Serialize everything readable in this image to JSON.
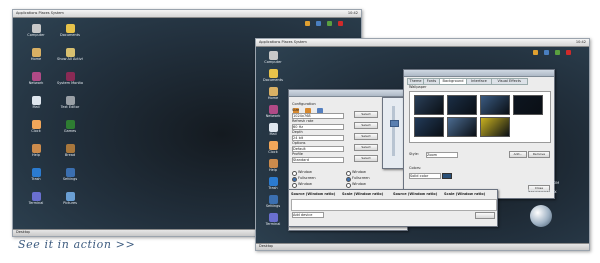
{
  "caption": "See it in action >>",
  "left_screen": {
    "top_panel": {
      "start_label": "Applications  Places  System",
      "clock": "10:42"
    },
    "desktop_icons": [
      {
        "label": "Computer",
        "color": "#c8c8c8"
      },
      {
        "label": "Documents",
        "color": "#e8c34a"
      },
      {
        "label": "Home",
        "color": "#d9b064"
      },
      {
        "label": "Show All Activity",
        "color": "#d8c070"
      },
      {
        "label": "Network",
        "color": "#b04a86"
      },
      {
        "label": "System Monitor",
        "color": "#8a2a55"
      },
      {
        "label": "Mail",
        "color": "#dfe6ee"
      },
      {
        "label": "Text Editor",
        "color": "#9aa0a6"
      },
      {
        "label": "Clock",
        "color": "#f0a65a"
      },
      {
        "label": "Games",
        "color": "#2e7d32"
      },
      {
        "label": "Help",
        "color": "#cc8b4c"
      },
      {
        "label": "Bread",
        "color": "#a8773c"
      },
      {
        "label": "Trash",
        "color": "#2b7bd0"
      },
      {
        "label": "Settings",
        "color": "#3b6fb0"
      },
      {
        "label": "Terminal",
        "color": "#6a6fcf"
      },
      {
        "label": "Pictures",
        "color": "#6a9fd4"
      }
    ],
    "bottom_panel": {
      "start_label": "Desktop"
    }
  },
  "right_screen": {
    "top_panel": {
      "start_label": "Applications  Places  System",
      "clock": "10:42"
    },
    "desktop_icons": [
      {
        "label": "Computer",
        "color": "#c8c8c8"
      },
      {
        "label": "Documents",
        "color": "#e8c34a"
      },
      {
        "label": "Home",
        "color": "#d9b064"
      },
      {
        "label": "Network",
        "color": "#b04a86"
      },
      {
        "label": "Mail",
        "color": "#dfe6ee"
      },
      {
        "label": "Clock",
        "color": "#f0a65a"
      },
      {
        "label": "Help",
        "color": "#cc8b4c"
      },
      {
        "label": "Trash",
        "color": "#2b7bd0"
      },
      {
        "label": "Settings",
        "color": "#3b6fb0"
      },
      {
        "label": "Terminal",
        "color": "#6a6fcf"
      }
    ],
    "appearance_dialog": {
      "title": "Appearance Preferences",
      "tabs": [
        "Theme",
        "Fonts",
        "Background",
        "Interface",
        "Visual Effects"
      ],
      "active_tab": "Background",
      "section_label": "Wallpaper",
      "thumb_colors": [
        "#2a3f58",
        "#1b2e45",
        "#3a5a80",
        "#0d1520",
        "#223a58",
        "#4b6b90",
        "#c8b020"
      ],
      "style_label": "Style:",
      "style_value": "Zoom",
      "colors_label": "Colors:",
      "colors_value": "Solid color",
      "add_button": "Add...",
      "remove_button": "Remove",
      "close_button": "Close"
    },
    "config_dialog": {
      "title": "Configuration",
      "rows": [
        {
          "label": "Size",
          "value": "1024x768",
          "button": "Select"
        },
        {
          "label": "Refresh rate",
          "value": "60 Hz",
          "button": "Select"
        },
        {
          "label": "Depth",
          "value": "24 bit",
          "button": "Select"
        },
        {
          "label": "Options",
          "value": "Default",
          "button": "Select"
        },
        {
          "label": "Profile",
          "value": "Standard",
          "button": "Select"
        }
      ],
      "radio_left": [
        "Window",
        "Fullscreen",
        "Window"
      ],
      "radio_right": [
        "Window",
        "Fullscreen",
        "Window"
      ],
      "columns": [
        "Source (Window ratio)",
        "Scale (Window ratio)",
        "Source (Window ratio)",
        "Scale (Window ratio)"
      ],
      "footer_field": "Add device"
    },
    "logo": {
      "line1": "YOUR OS FREEDOM",
      "line2": "Dreamlinux"
    },
    "bottom_panel": {
      "start_label": "Desktop"
    }
  }
}
